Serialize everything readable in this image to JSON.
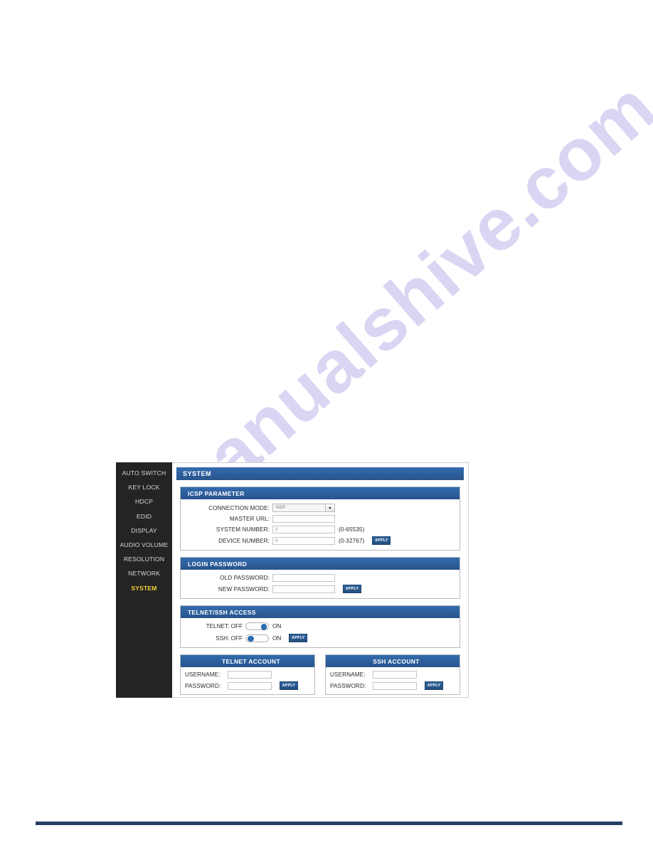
{
  "watermark": {
    "text": "manualshive.com"
  },
  "webui": {
    "sidebar": {
      "items": [
        {
          "label": "AUTO SWITCH",
          "active": false
        },
        {
          "label": "KEY LOCK",
          "active": false
        },
        {
          "label": "HDCP",
          "active": false
        },
        {
          "label": "EDID",
          "active": false
        },
        {
          "label": "DISPLAY",
          "active": false
        },
        {
          "label": "AUDIO VOLUME",
          "active": false
        },
        {
          "label": "RESOLUTION",
          "active": false
        },
        {
          "label": "NETWORK",
          "active": false
        },
        {
          "label": "SYSTEM",
          "active": true
        }
      ]
    },
    "page_title": "SYSTEM",
    "icsp": {
      "title": "ICSP PARAMETER",
      "connection_mode_label": "CONNECTION MODE:",
      "connection_mode_value": "NDP",
      "master_url_label": "MASTER URL:",
      "master_url_value": "",
      "system_number_label": "SYSTEM NUMBER:",
      "system_number_value": "0",
      "system_number_hint": "(0-65535)",
      "device_number_label": "DEVICE NUMBER:",
      "device_number_value": "0",
      "device_number_hint": "(0-32767)",
      "apply_label": "APPLY"
    },
    "login_password": {
      "title": "LOGIN PASSWORD",
      "old_label": "OLD PASSWORD:",
      "old_value": "",
      "new_label": "NEW PASSWORD:",
      "new_value": "",
      "apply_label": "APPLY"
    },
    "telnet_ssh_access": {
      "title": "TELNET/SSH ACCESS",
      "telnet_label": "TELNET: OFF",
      "telnet_on_label": "ON",
      "telnet_state": "on",
      "ssh_label": "SSH: OFF",
      "ssh_on_label": "ON",
      "ssh_state": "off",
      "apply_label": "APPLY"
    },
    "telnet_account": {
      "title": "TELNET ACCOUNT",
      "username_label": "USERNAME:",
      "username_value": "",
      "password_label": "PASSWORD:",
      "password_value": "",
      "apply_label": "APPLY"
    },
    "ssh_account": {
      "title": "SSH ACCOUNT",
      "username_label": "USERNAME:",
      "username_value": "",
      "password_label": "PASSWORD:",
      "password_value": "",
      "apply_label": "APPLY"
    }
  },
  "colors": {
    "header_blue": "#2c5f9e",
    "sidebar_dark": "#242424",
    "active_nav": "#f2d03c",
    "footer_rule": "#243f63",
    "watermark": "#d3d0f2"
  }
}
